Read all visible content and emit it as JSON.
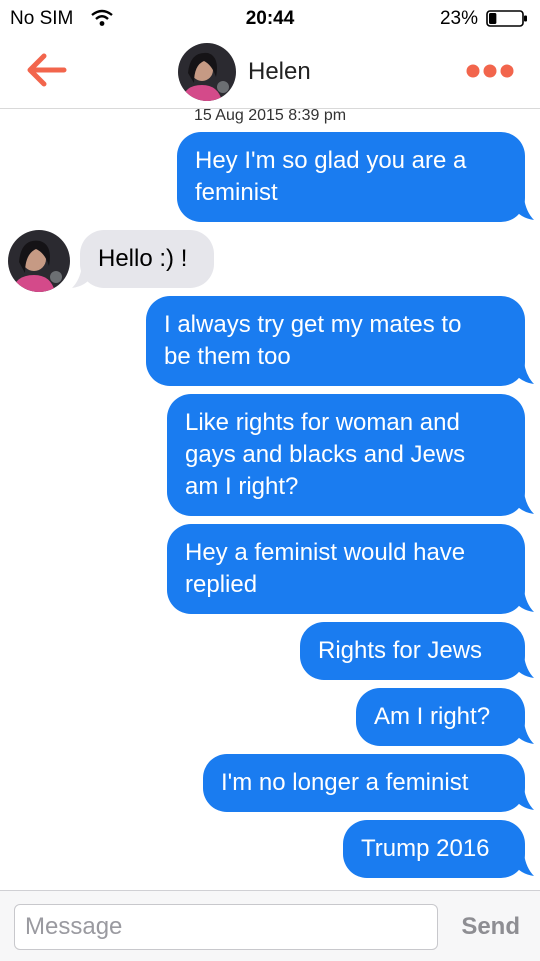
{
  "status_bar": {
    "carrier": "No SIM",
    "time": "20:44",
    "battery_percent": "23%",
    "battery_level": 0.23
  },
  "header": {
    "contact_name": "Helen"
  },
  "thread": {
    "timestamp": "15 Aug 2015 8:39 pm",
    "messages": [
      {
        "direction": "outgoing",
        "lines": [
          "Hey I'm so glad you are a",
          "feminist"
        ]
      },
      {
        "direction": "incoming",
        "lines": [
          "Hello :) !"
        ]
      },
      {
        "direction": "outgoing",
        "lines": [
          "I always try get my mates to",
          "be them too"
        ]
      },
      {
        "direction": "outgoing",
        "lines": [
          "Like rights for woman and",
          "gays and blacks and Jews",
          "am I right?"
        ]
      },
      {
        "direction": "outgoing",
        "lines": [
          "Hey a feminist would have",
          "replied"
        ]
      },
      {
        "direction": "outgoing",
        "lines": [
          "Rights for Jews"
        ]
      },
      {
        "direction": "outgoing",
        "lines": [
          "Am I right?"
        ]
      },
      {
        "direction": "outgoing",
        "lines": [
          "I'm no longer a feminist"
        ]
      },
      {
        "direction": "outgoing",
        "lines": [
          "Trump 2016"
        ]
      }
    ]
  },
  "composer": {
    "placeholder": "Message",
    "send_label": "Send"
  },
  "colors": {
    "accent": "#f2654c",
    "bubble_outgoing": "#1a7cf0",
    "bubble_incoming": "#e6e6eb"
  }
}
